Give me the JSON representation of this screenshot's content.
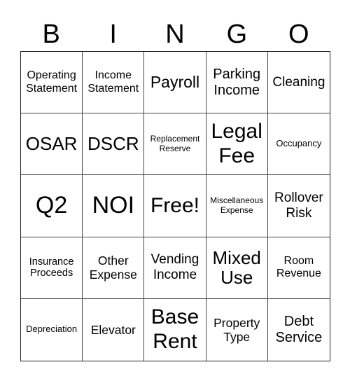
{
  "header": [
    "B",
    "I",
    "N",
    "G",
    "O"
  ],
  "cells": [
    [
      "Operating Statement",
      "Income Statement",
      "Payroll",
      "Parking Income",
      "Cleaning"
    ],
    [
      "OSAR",
      "DSCR",
      "Replacement Reserve",
      "Legal Fee",
      "Occupancy"
    ],
    [
      "Q2",
      "NOI",
      "Free!",
      "Miscellaneous Expense",
      "Rollover Risk"
    ],
    [
      "Insurance Proceeds",
      "Other Expense",
      "Vending Income",
      "Mixed Use",
      "Room Revenue"
    ],
    [
      "Depreciation",
      "Elevator",
      "Base Rent",
      "Property Type",
      "Debt Service"
    ]
  ]
}
